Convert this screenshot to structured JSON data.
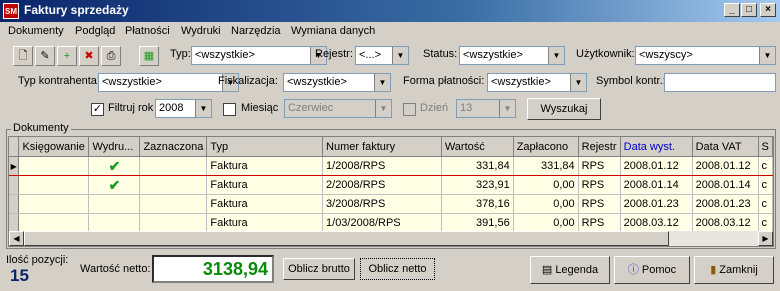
{
  "window": {
    "title": "Faktury sprzedaży",
    "icon_text": "SM"
  },
  "menu": [
    "Dokumenty",
    "Podgląd",
    "Płatności",
    "Wydruki",
    "Narzędzia",
    "Wymiana danych"
  ],
  "filters": {
    "typ_label": "Typ:",
    "typ_value": "<wszystkie>",
    "rejestr_label": "Rejestr:",
    "rejestr_value": "<...>",
    "status_label": "Status:",
    "status_value": "<wszystkie>",
    "uzytkownik_label": "Użytkownik:",
    "uzytkownik_value": "<wszyscy>",
    "typ_kontrahenta_label": "Typ kontrahenta:",
    "typ_kontrahenta_value": "<wszystkie>",
    "fiskalizacja_label": "Fiskalizacja:",
    "fiskalizacja_value": "<wszystkie>",
    "forma_platnosci_label": "Forma płatności:",
    "forma_platnosci_value": "<wszystkie>",
    "symbol_label": "Symbol kontr.:",
    "symbol_value": "",
    "filtruj_rok_label": "Filtruj rok",
    "filtruj_rok_checked": true,
    "rok_value": "2008",
    "miesiac_label": "Miesiąc",
    "miesiac_value": "Czerwiec",
    "dzien_label": "Dzień",
    "dzien_value": "13",
    "search_button": "Wyszukaj"
  },
  "documents": {
    "group_title": "Dokumenty",
    "columns": [
      "Księgowanie",
      "Wydru...",
      "Zaznaczona",
      "Typ",
      "Numer faktury",
      "Wartość",
      "Zapłacono",
      "Rejestr",
      "Data wyst.",
      "Data VAT",
      "S"
    ],
    "rows": [
      {
        "ksiegowanie": "",
        "wydruk": true,
        "zaznaczona": "",
        "typ": "Faktura",
        "numer": "1/2008/RPS",
        "wartosc": "331,84",
        "zaplacono": "331,84",
        "rejestr": "RPS",
        "data_wyst": "2008.01.12",
        "data_vat": "2008.01.12",
        "s": "c"
      },
      {
        "ksiegowanie": "",
        "wydruk": true,
        "zaznaczona": "",
        "typ": "Faktura",
        "numer": "2/2008/RPS",
        "wartosc": "323,91",
        "zaplacono": "0,00",
        "rejestr": "RPS",
        "data_wyst": "2008.01.14",
        "data_vat": "2008.01.14",
        "s": "c"
      },
      {
        "ksiegowanie": "",
        "wydruk": false,
        "zaznaczona": "",
        "typ": "Faktura",
        "numer": "3/2008/RPS",
        "wartosc": "378,16",
        "zaplacono": "0,00",
        "rejestr": "RPS",
        "data_wyst": "2008.01.23",
        "data_vat": "2008.01.23",
        "s": "c"
      },
      {
        "ksiegowanie": "",
        "wydruk": false,
        "zaznaczona": "",
        "typ": "Faktura",
        "numer": "1/03/2008/RPS",
        "wartosc": "391,56",
        "zaplacono": "0,00",
        "rejestr": "RPS",
        "data_wyst": "2008.03.12",
        "data_vat": "2008.03.12",
        "s": "c"
      }
    ]
  },
  "footer": {
    "ilosc_label": "Ilość pozycji:",
    "ilosc_value": "15",
    "netto_label": "Wartość netto:",
    "netto_value": "3138,94",
    "oblicz_brutto": "Oblicz brutto",
    "oblicz_netto": "Oblicz netto",
    "legenda": "Legenda",
    "pomoc": "Pomoc",
    "zamknij": "Zamknij"
  },
  "colors": {
    "accent_header": "#0000cc",
    "netto_value": "#0a8a0a",
    "check": "#1a9e1a",
    "selected_row_border": "#cc0000"
  }
}
